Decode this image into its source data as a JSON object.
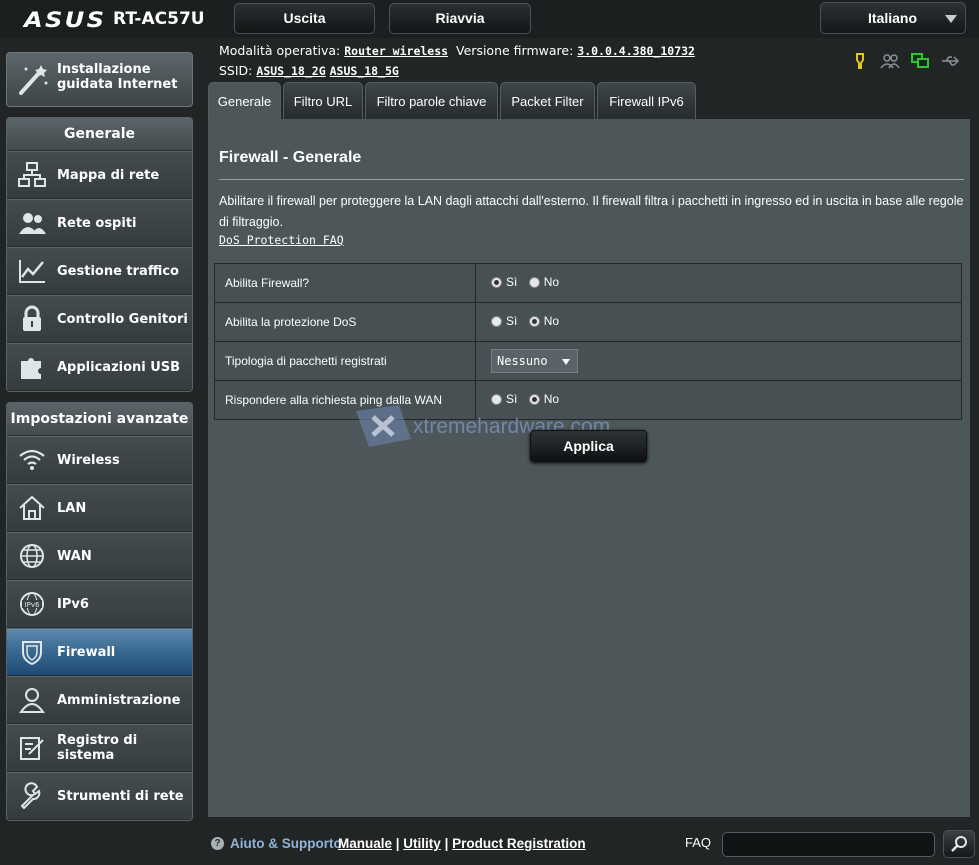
{
  "header": {
    "brand": "ASUS",
    "model": "RT-AC57U",
    "logout_label": "Uscita",
    "reboot_label": "Riavvia",
    "language": "Italiano"
  },
  "status": {
    "mode_label": "Modalità operativa:",
    "mode_value": "Router wireless",
    "firmware_label": "Versione firmware:",
    "firmware_value": "3.0.0.4.380_10732",
    "ssid_label": "SSID:",
    "ssid_2g": "ASUS_18_2G",
    "ssid_5g": "ASUS_18_5G"
  },
  "sidebar": {
    "qis_label_line1": "Installazione",
    "qis_label_line2": "guidata Internet",
    "general_title": "Generale",
    "general_items": [
      {
        "label": "Mappa di rete"
      },
      {
        "label": "Rete ospiti"
      },
      {
        "label": "Gestione traffico"
      },
      {
        "label": "Controllo Genitori"
      },
      {
        "label": "Applicazioni USB"
      }
    ],
    "advanced_title": "Impostazioni avanzate",
    "advanced_items": [
      {
        "label": "Wireless"
      },
      {
        "label": "LAN"
      },
      {
        "label": "WAN"
      },
      {
        "label": "IPv6"
      },
      {
        "label": "Firewall"
      },
      {
        "label": "Amministrazione"
      },
      {
        "label": "Registro di sistema"
      },
      {
        "label": "Strumenti di rete"
      }
    ],
    "active_item": "Firewall"
  },
  "tabs": [
    {
      "label": "Generale"
    },
    {
      "label": "Filtro URL"
    },
    {
      "label": "Filtro parole chiave"
    },
    {
      "label": "Packet Filter"
    },
    {
      "label": "Firewall IPv6"
    }
  ],
  "main": {
    "title": "Firewall - Generale",
    "description": "Abilitare il firewall per proteggere la LAN dagli attacchi dall'esterno. Il firewall filtra i pacchetti in ingresso ed in uscita in base alle regole di filtraggio.",
    "faq_link": "DoS Protection FAQ",
    "yes_label": "Sì",
    "no_label": "No",
    "rows": [
      {
        "label": "Abilita Firewall?",
        "value": "Sì"
      },
      {
        "label": "Abilita la protezione DoS",
        "value": "No"
      },
      {
        "label": "Tipologia di pacchetti registrati",
        "value": "Nessuno"
      },
      {
        "label": "Rispondere alla richiesta ping dalla WAN",
        "value": "No"
      }
    ],
    "apply_label": "Applica",
    "watermark": "xtremehardware.com"
  },
  "footer": {
    "help_label": "Aiuto & Supporto",
    "manual": "Manuale",
    "utility": "Utility",
    "registration": "Product Registration",
    "faq_label": "FAQ",
    "search_placeholder": ""
  }
}
